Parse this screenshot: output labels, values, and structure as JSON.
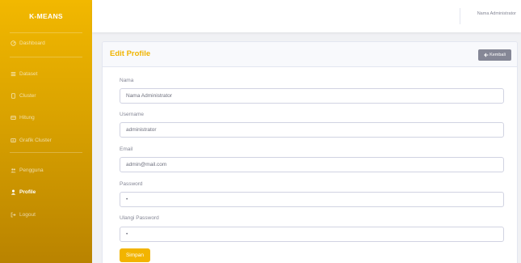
{
  "sidebar": {
    "brand": "K-MEANS",
    "items": [
      {
        "label": "Dashboard",
        "icon": "dashboard-icon"
      },
      {
        "label": "Dataset",
        "icon": "list-icon"
      },
      {
        "label": "Cluster",
        "icon": "cluster-icon"
      },
      {
        "label": "Hitung",
        "icon": "calculator-icon"
      },
      {
        "label": "Grafik Cluster",
        "icon": "chart-icon"
      },
      {
        "label": "Pengguna",
        "icon": "users-icon"
      },
      {
        "label": "Profile",
        "icon": "user-icon",
        "active": true
      },
      {
        "label": "Logout",
        "icon": "logout-icon"
      }
    ]
  },
  "topbar": {
    "user_name": "Nama Administrator"
  },
  "card": {
    "title": "Edit Profile",
    "back_label": "Kembali",
    "fields": [
      {
        "label": "Nama",
        "value": "Nama Administrator"
      },
      {
        "label": "Username",
        "value": "administrator"
      },
      {
        "label": "Email",
        "value": "admin@mail.com"
      },
      {
        "label": "Password",
        "value": "•"
      },
      {
        "label": "Ulangi Password",
        "value": "•"
      }
    ],
    "save_label": "Simpan"
  },
  "colors": {
    "accent": "#f2b400",
    "sidebar_top": "#f2b800",
    "sidebar_bottom": "#b98300",
    "secondary_button": "#858796"
  }
}
